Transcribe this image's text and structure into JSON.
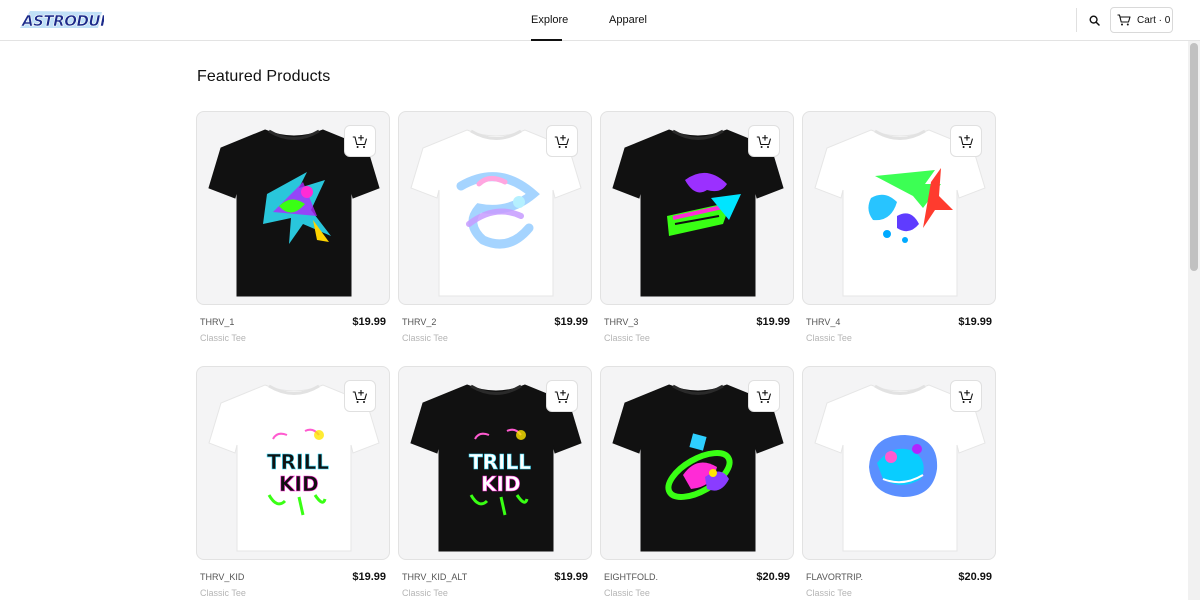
{
  "brand": {
    "logo_text": "ASTRODUR"
  },
  "nav": {
    "items": [
      {
        "label": "Explore",
        "active": true
      },
      {
        "label": "Apparel",
        "active": false
      }
    ]
  },
  "header": {
    "cart_label": "Cart · 0",
    "search_icon": "search-icon",
    "cart_icon": "cart-icon"
  },
  "main": {
    "section_title": "Featured Products"
  },
  "products": [
    {
      "name": "THRV_1",
      "type": "Classic Tee",
      "price": "$19.99",
      "shirt_color": "#111111",
      "art": "neon-bird"
    },
    {
      "name": "THRV_2",
      "type": "Classic Tee",
      "price": "$19.99",
      "shirt_color": "#ffffff",
      "art": "pastel-swirl"
    },
    {
      "name": "THRV_3",
      "type": "Classic Tee",
      "price": "$19.99",
      "shirt_color": "#111111",
      "art": "neon-graffiti"
    },
    {
      "name": "THRV_4",
      "type": "Classic Tee",
      "price": "$19.99",
      "shirt_color": "#ffffff",
      "art": "neon-arrows"
    },
    {
      "name": "THRV_KID",
      "type": "Classic Tee",
      "price": "$19.99",
      "shirt_color": "#ffffff",
      "art": "trill-kid"
    },
    {
      "name": "THRV_KID_ALT",
      "type": "Classic Tee",
      "price": "$19.99",
      "shirt_color": "#111111",
      "art": "trill-kid"
    },
    {
      "name": "EIGHTFOLD.",
      "type": "Classic Tee",
      "price": "$20.99",
      "shirt_color": "#111111",
      "art": "ring-orbit"
    },
    {
      "name": "FLAVORTRIP.",
      "type": "Classic Tee",
      "price": "$20.99",
      "shirt_color": "#ffffff",
      "art": "flavor-blob"
    }
  ],
  "colors": {
    "accent": "#111111",
    "card_bg": "#f4f4f5",
    "muted": "#b5b5b5"
  }
}
